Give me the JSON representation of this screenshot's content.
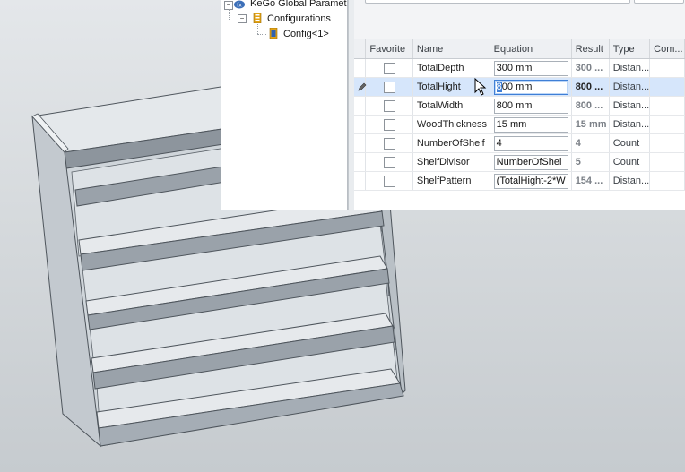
{
  "tree": {
    "root_label": "KeGo Global Parameters",
    "root_badge": "fx",
    "configurations_label": "Configurations",
    "config_label": "Config<1>"
  },
  "grid": {
    "columns": [
      "Favorite",
      "Name",
      "Equation",
      "Result",
      "Type",
      "Com..."
    ],
    "rows": [
      {
        "name": "TotalDepth",
        "equation": "300 mm",
        "result": "300 ...",
        "type": "Distan..."
      },
      {
        "name": "TotalHight",
        "equation_pre": "8",
        "equation": "00 mm",
        "result": "800 ...",
        "type": "Distan..."
      },
      {
        "name": "TotalWidth",
        "equation": "800 mm",
        "result": "800 ...",
        "type": "Distan..."
      },
      {
        "name": "WoodThickness",
        "equation": "15 mm",
        "result": "15 mm",
        "type": "Distan..."
      },
      {
        "name": "NumberOfShelf",
        "equation": "4",
        "result": "4",
        "type": "Count"
      },
      {
        "name": "ShelfDivisor",
        "equation": "NumberOfShel",
        "result": "5",
        "type": "Count"
      },
      {
        "name": "ShelfPattern",
        "equation": "(TotalHight-2*W",
        "result": "154 ...",
        "type": "Distan..."
      }
    ],
    "selected_row": 1
  },
  "icons": {
    "edit_row": "pencil-icon",
    "mouse_cursor": "arrow-cursor-icon",
    "expand": "minus-box-icon",
    "config_folder": "configuration-icon",
    "config_item": "config-icon",
    "root": "fx-icon"
  },
  "colors": {
    "selection": "#d6e6fb",
    "focus_border": "#3f7fd6",
    "shelf_top": "#dfe3e7",
    "shelf_front": "#a5adb5"
  }
}
